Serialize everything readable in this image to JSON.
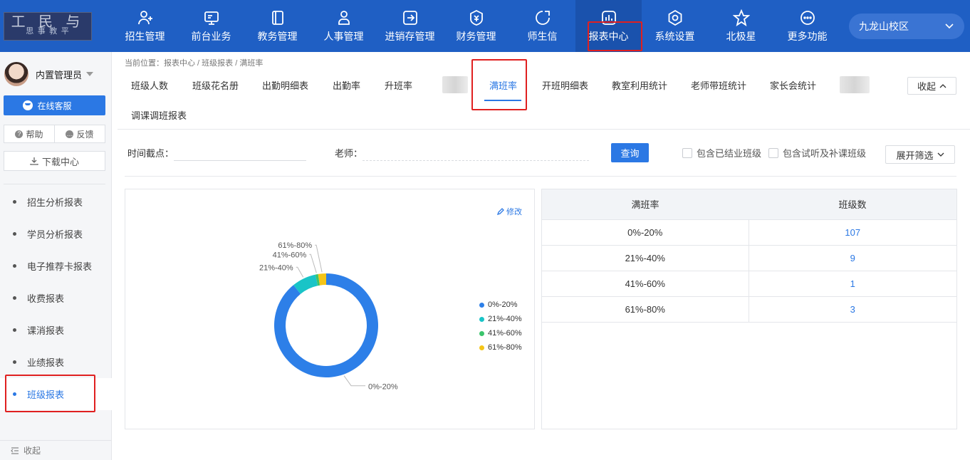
{
  "logo": {
    "line1": "工 民 与",
    "line2": "思 事 教 平"
  },
  "nav": {
    "items": [
      {
        "label": "招生管理",
        "icon": "user-plus-icon"
      },
      {
        "label": "前台业务",
        "icon": "monitor-icon"
      },
      {
        "label": "教务管理",
        "icon": "book-icon"
      },
      {
        "label": "人事管理",
        "icon": "person-icon"
      },
      {
        "label": "进销存管理",
        "icon": "box-arrow-icon"
      },
      {
        "label": "财务管理",
        "icon": "money-bag-icon"
      },
      {
        "label": "师生信",
        "icon": "chat-bubble-icon"
      },
      {
        "label": "报表中心",
        "icon": "bar-chart-icon"
      },
      {
        "label": "系统设置",
        "icon": "settings-icon"
      },
      {
        "label": "北极星",
        "icon": "star-icon"
      },
      {
        "label": "更多功能",
        "icon": "more-icon"
      }
    ],
    "active_index": 7
  },
  "campus": {
    "label": "九龙山校区"
  },
  "sidebar": {
    "user_name": "内置管理员",
    "service_label": "在线客服",
    "help_label": "帮助",
    "feedback_label": "反馈",
    "download_label": "下载中心",
    "menu": [
      "招生分析报表",
      "学员分析报表",
      "电子推荐卡报表",
      "收费报表",
      "课消报表",
      "业绩报表",
      "班级报表"
    ],
    "active_menu": 6,
    "collapse_label": "收起"
  },
  "breadcrumb": "当前位置：报表中心 / 班级报表 / 满班率",
  "tabs": {
    "items": [
      "班级人数",
      "班级花名册",
      "出勤明细表",
      "出勤率",
      "升班率",
      "满班率",
      "开班明细表",
      "教室利用统计",
      "老师带班统计",
      "家长会统计",
      "调课调班报表"
    ],
    "active": "满班率",
    "collapse_label": "收起"
  },
  "filters": {
    "time_label": "时间截点：",
    "teacher_label": "老师：",
    "query_label": "查询",
    "include_graduated": "包含已结业班级",
    "include_trial": "包含试听及补课班级",
    "expand_label": "展开筛选"
  },
  "chart_panel": {
    "edit_label": "修改"
  },
  "chart_data": {
    "type": "pie",
    "donut": true,
    "title": "",
    "categories": [
      "0%-20%",
      "21%-40%",
      "41%-60%",
      "61%-80%"
    ],
    "values": [
      107,
      9,
      1,
      3
    ],
    "colors": [
      "#2d7fe8",
      "#19c4c7",
      "#3bc46c",
      "#f5c518"
    ],
    "legend_position": "right"
  },
  "table": {
    "headers": [
      "满班率",
      "班级数"
    ],
    "rows": [
      {
        "rate": "0%-20%",
        "count": "107"
      },
      {
        "rate": "21%-40%",
        "count": "9"
      },
      {
        "rate": "41%-60%",
        "count": "1"
      },
      {
        "rate": "61%-80%",
        "count": "3"
      }
    ]
  }
}
